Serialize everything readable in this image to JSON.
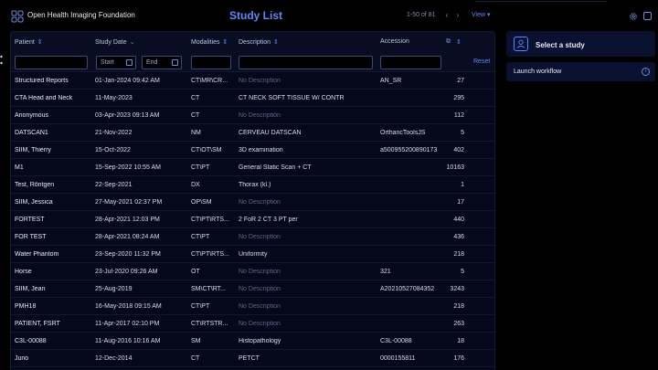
{
  "header": {
    "brand": "Open Health Imaging Foundation",
    "title": "Study List",
    "pagination": "1-50 of 81",
    "prev_icon": "chevron-left-icon",
    "next_icon": "chevron-right-icon",
    "view_label": "View",
    "settings_icon": "gear-icon",
    "sidebar_icon": "panel-toggle-icon"
  },
  "table": {
    "columns": [
      "Patient",
      "Study Date",
      "Modalities",
      "Description",
      "Accession"
    ],
    "filters": {
      "patient": "",
      "start_placeholder": "Start",
      "end_placeholder": "End",
      "modalities": "",
      "description": "",
      "accession": "",
      "reset_label": "Reset"
    },
    "rows": [
      {
        "patient": "Structured Reports",
        "date": "01-Jan-2024 09:42 AM",
        "modalities": "CT\\MR\\CR...",
        "description": "No Description",
        "accession": "AN_SR",
        "instances": "27"
      },
      {
        "patient": "CTA Head and Neck",
        "date": "11-May-2023",
        "modalities": "CT",
        "description": "CT NECK SOFT TISSUE W/ CONTR",
        "accession": "",
        "instances": "295"
      },
      {
        "patient": "Anonymous",
        "date": "03-Apr-2023 09:13 AM",
        "modalities": "CT",
        "description": "No Description",
        "accession": "",
        "instances": "112"
      },
      {
        "patient": "DATSCAN1",
        "date": "21-Nov-2022",
        "modalities": "NM",
        "description": "CERVEAU DATSCAN",
        "accession": "OrthancToolsJS",
        "instances": "5"
      },
      {
        "patient": "SIIM, Thierry",
        "date": "15-Oct-2022",
        "modalities": "CT\\OT\\SM",
        "description": "3D examination",
        "accession": "a500955200890173",
        "instances": "402"
      },
      {
        "patient": "M1",
        "date": "15-Sep-2022 10:55 AM",
        "modalities": "CT\\PT",
        "description": "General Static Scan + CT",
        "accession": "",
        "instances": "10163"
      },
      {
        "patient": "Test, Röntgen",
        "date": "22-Sep-2021",
        "modalities": "DX",
        "description": "Thorax (kl.)",
        "accession": "",
        "instances": "1"
      },
      {
        "patient": "SIIM, Jessica",
        "date": "27-May-2021 02:37 PM",
        "modalities": "OP\\SM",
        "description": "No Description",
        "accession": "",
        "instances": "17"
      },
      {
        "patient": "FORTEST",
        "date": "28-Apr-2021 12:03 PM",
        "modalities": "CT\\PT\\RTS...",
        "description": "2 FoR 2 CT 3 PT per",
        "accession": "",
        "instances": "440"
      },
      {
        "patient": "FOR TEST",
        "date": "28-Apr-2021 08:24 AM",
        "modalities": "CT\\PT",
        "description": "No Description",
        "accession": "",
        "instances": "436"
      },
      {
        "patient": "Water Phantom",
        "date": "23-Sep-2020 11:32 PM",
        "modalities": "CT\\PT\\RTS...",
        "description": "Uniformity",
        "accession": "",
        "instances": "218"
      },
      {
        "patient": "Horse",
        "date": "23-Jul-2020 09:26 AM",
        "modalities": "OT",
        "description": "No Description",
        "accession": "321",
        "instances": "5"
      },
      {
        "patient": "SIIM, Jean",
        "date": "25-Aug-2019",
        "modalities": "SM\\CT\\RT...",
        "description": "No Description",
        "accession": "A20210527084352",
        "instances": "3243"
      },
      {
        "patient": "PMH18",
        "date": "16-May-2018 09:15 AM",
        "modalities": "CT\\PT",
        "description": "No Description",
        "accession": "",
        "instances": "218"
      },
      {
        "patient": "PATIENT, FSRT",
        "date": "11-Apr-2017 02:10 PM",
        "modalities": "CT\\RTSTR...",
        "description": "No Description",
        "accession": "",
        "instances": "263"
      },
      {
        "patient": "C3L-00088",
        "date": "11-Aug-2016 10:16 AM",
        "modalities": "SM",
        "description": "Histopathology",
        "accession": "C3L-00088",
        "instances": "18"
      },
      {
        "patient": "Juno",
        "date": "12-Dec-2014",
        "modalities": "CT",
        "description": "PETCT",
        "accession": "0000155811",
        "instances": "176"
      }
    ]
  },
  "side_panel": {
    "title": "Select a study",
    "workflow_label": "Launch workflow"
  },
  "colors": {
    "accent": "#5b8bff",
    "background": "#000000",
    "panel": "#05081a"
  }
}
